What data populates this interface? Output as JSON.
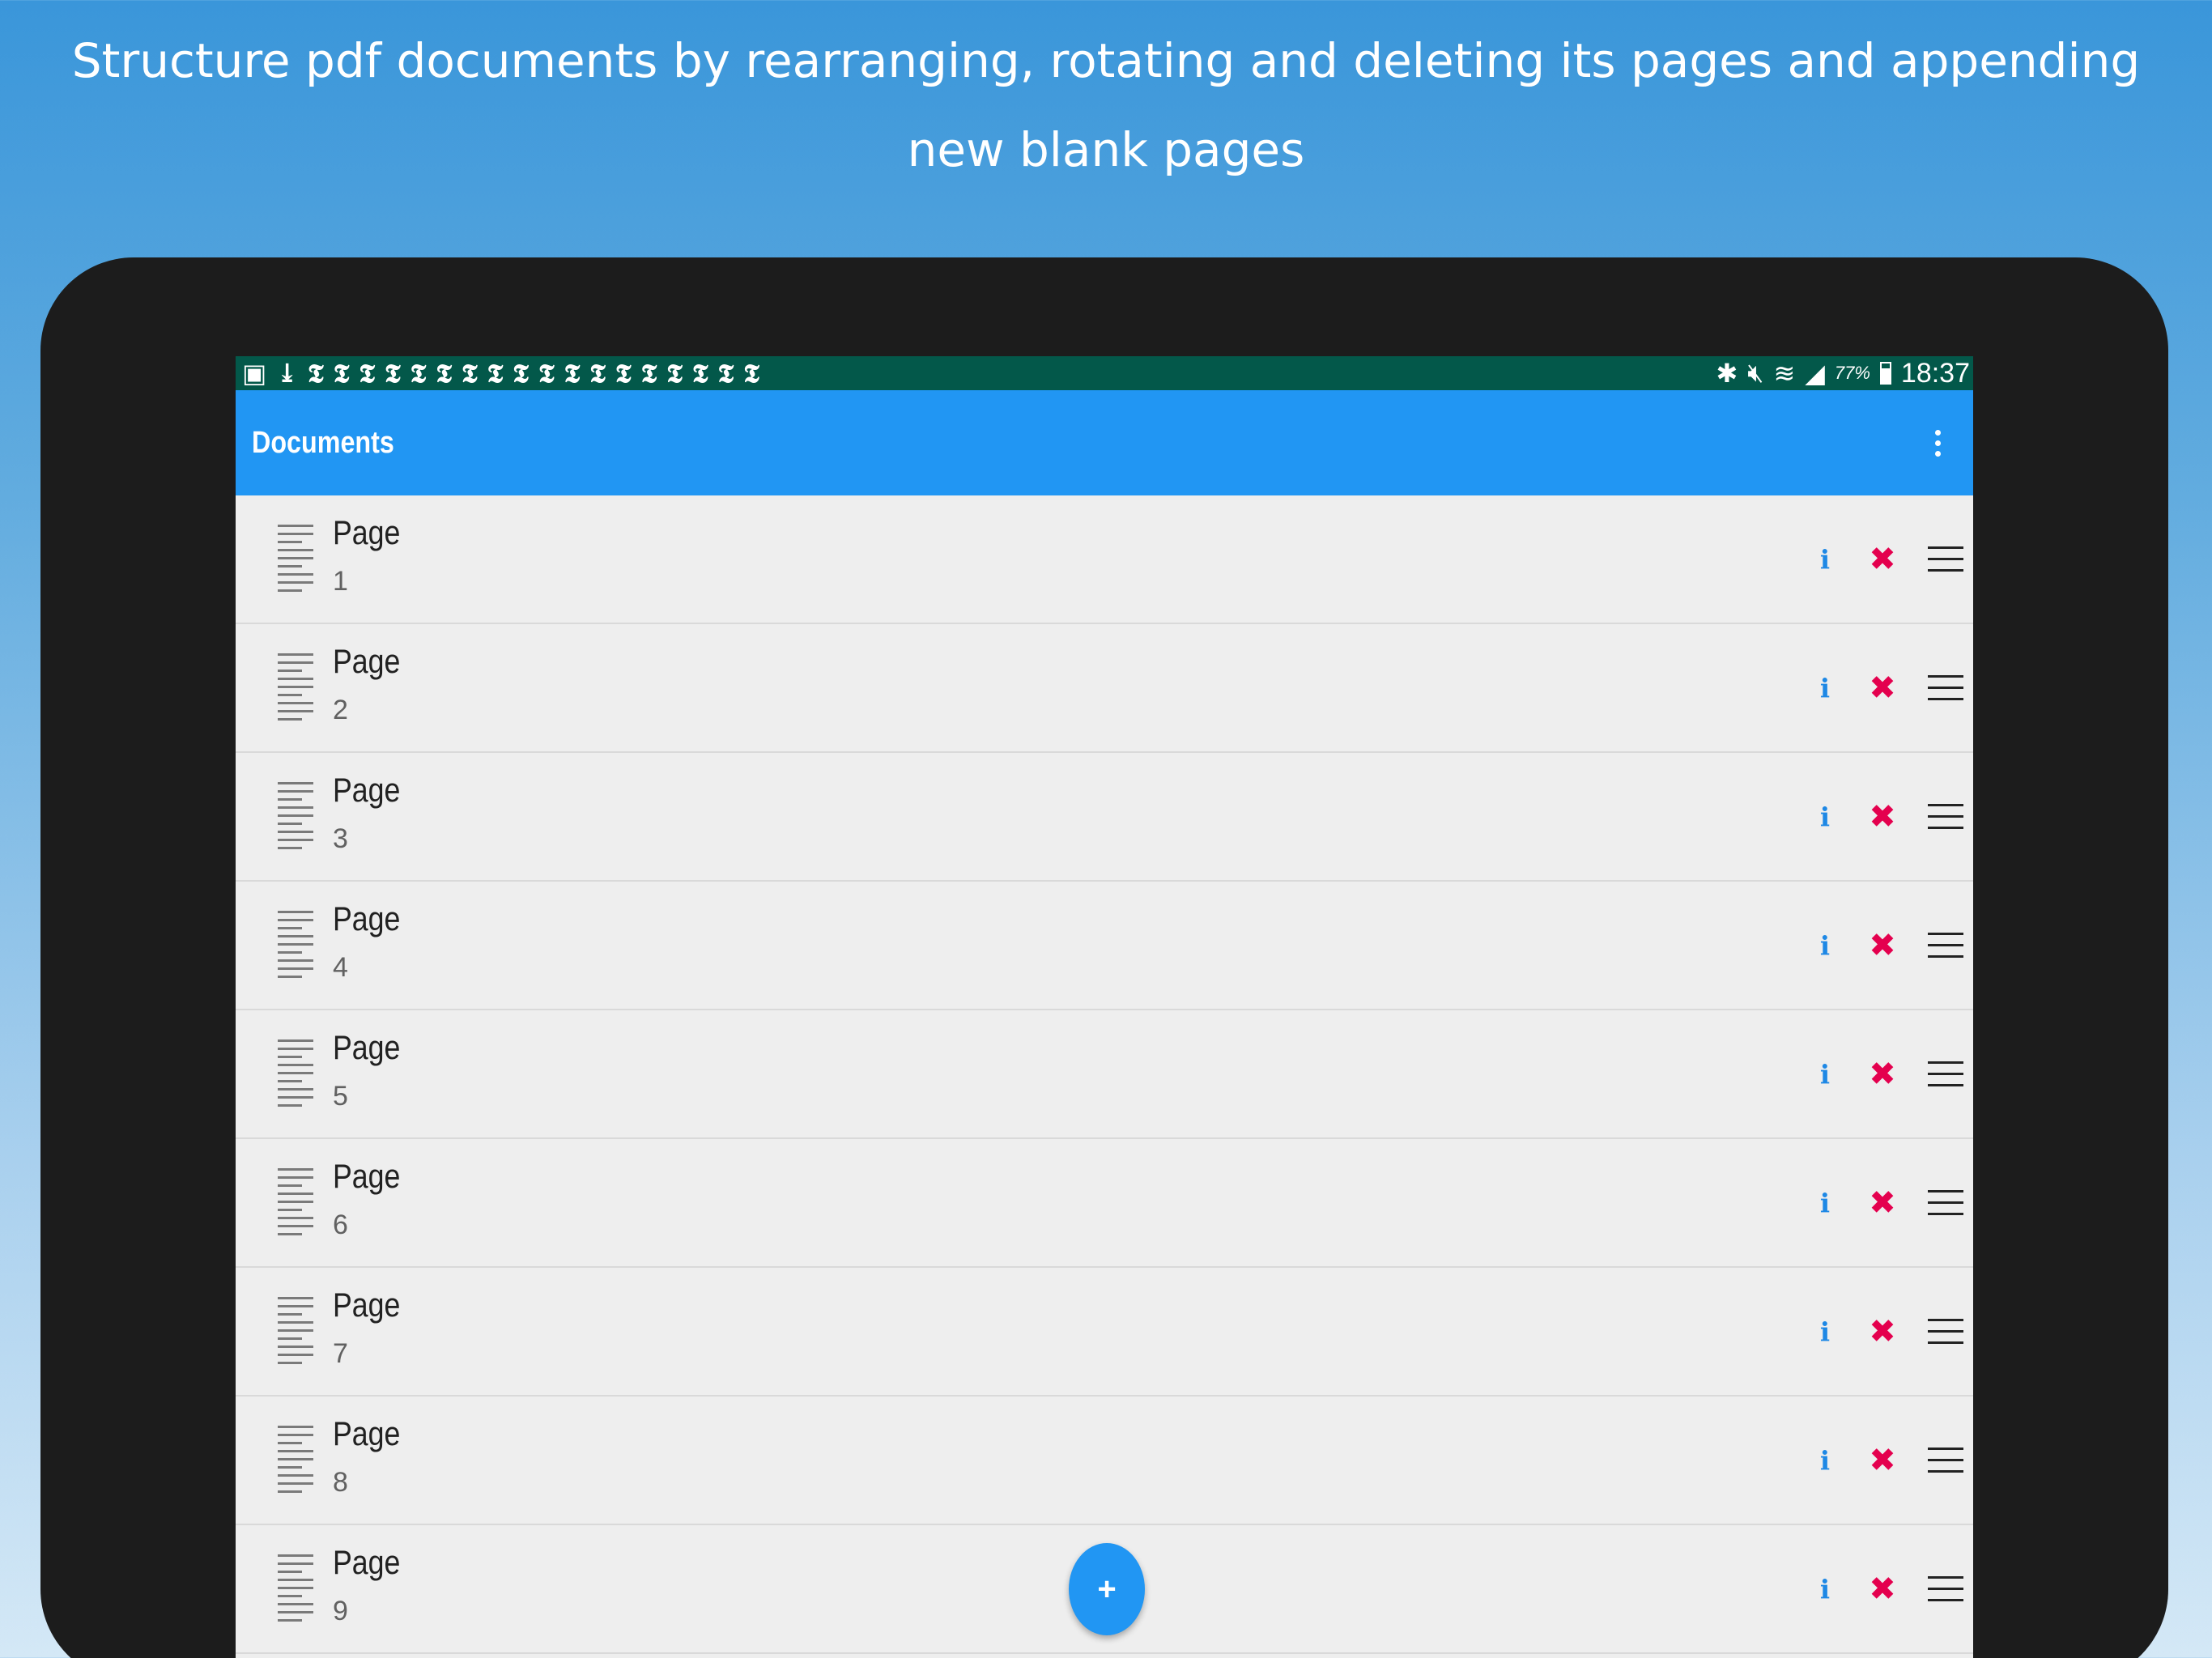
{
  "headline": "Structure pdf documents by rearranging, rotating and deleting its pages and appending new blank pages",
  "status_bar": {
    "notification_icons": [
      "image-icon",
      "download-icon",
      "nyt-icon",
      "nyt-icon",
      "nyt-icon",
      "nyt-icon",
      "nyt-icon",
      "nyt-icon",
      "nyt-icon",
      "nyt-icon",
      "nyt-icon",
      "nyt-icon",
      "nyt-icon",
      "nyt-icon",
      "nyt-icon",
      "nyt-icon",
      "nyt-icon",
      "nyt-icon",
      "nyt-icon",
      "nyt-icon"
    ],
    "battery_percent": "77%",
    "battery_level": 0.77,
    "time": "18:37"
  },
  "app_bar": {
    "title": "Documents"
  },
  "pages": [
    {
      "title": "Page",
      "number": "1"
    },
    {
      "title": "Page",
      "number": "2"
    },
    {
      "title": "Page",
      "number": "3"
    },
    {
      "title": "Page",
      "number": "4"
    },
    {
      "title": "Page",
      "number": "5"
    },
    {
      "title": "Page",
      "number": "6"
    },
    {
      "title": "Page",
      "number": "7"
    },
    {
      "title": "Page",
      "number": "8"
    },
    {
      "title": "Page",
      "number": "9"
    }
  ],
  "actions": {
    "info_glyph": "i",
    "delete_glyph": "✖",
    "add_glyph": "+"
  },
  "colors": {
    "status_bar": "#03584a",
    "app_bar": "#2196f3",
    "delete": "#e4004e",
    "info": "#1e88e5"
  }
}
